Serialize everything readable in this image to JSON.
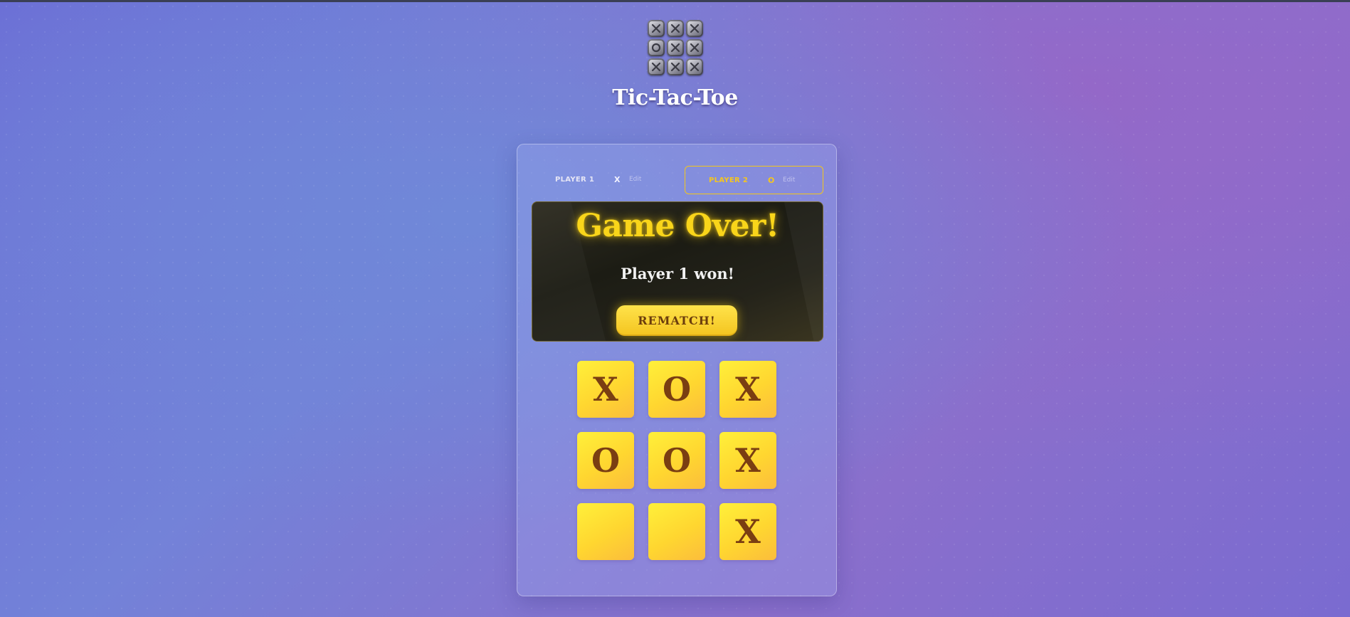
{
  "app": {
    "title": "Tic-Tac-Toe",
    "logo_icon": "tic-tac-toe-logo-icon",
    "logo_cells": [
      "X",
      "X",
      "X",
      "O",
      "X",
      "X",
      "X",
      "X",
      "X"
    ]
  },
  "players": [
    {
      "name": "PLAYER 1",
      "symbol": "X",
      "edit_label": "Edit",
      "active": false
    },
    {
      "name": "PLAYER 2",
      "symbol": "O",
      "edit_label": "Edit",
      "active": true
    }
  ],
  "game_over": {
    "title": "Game Over!",
    "message": "Player 1 won!",
    "rematch_label": "REMATCH!"
  },
  "board": {
    "cells": [
      "X",
      "O",
      "X",
      "O",
      "O",
      "X",
      "",
      "",
      "X"
    ]
  },
  "colors": {
    "accent": "#f9d51a",
    "cell_text": "#7a3e12",
    "panel_dark": "#1c1c14"
  }
}
